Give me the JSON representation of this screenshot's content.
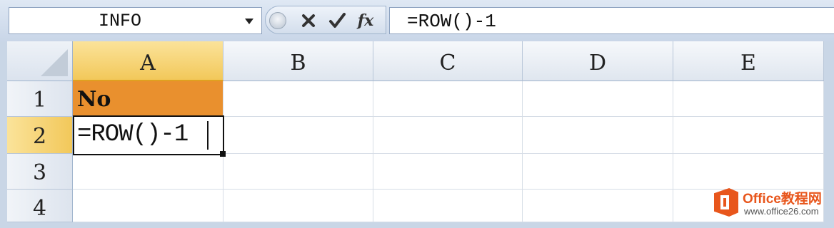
{
  "formula_bar": {
    "name_box": "INFO",
    "buttons": [
      {
        "name": "cancel",
        "icon": "x-icon"
      },
      {
        "name": "enter",
        "icon": "check-icon"
      },
      {
        "name": "insert-function",
        "label": "fx"
      }
    ],
    "formula": "=ROW()-1"
  },
  "sheet": {
    "columns": [
      "A",
      "B",
      "C",
      "D",
      "E"
    ],
    "rows": [
      "1",
      "2",
      "3",
      "4"
    ],
    "cells": {
      "A1": "No",
      "A2": "=ROW()-1"
    },
    "active_cell": "A2",
    "colors": {
      "header_fill": "#e9902e",
      "selected_header": "#f2c85a"
    }
  },
  "watermark": {
    "line1": "Office教程网",
    "line2": "www.office26.com"
  }
}
